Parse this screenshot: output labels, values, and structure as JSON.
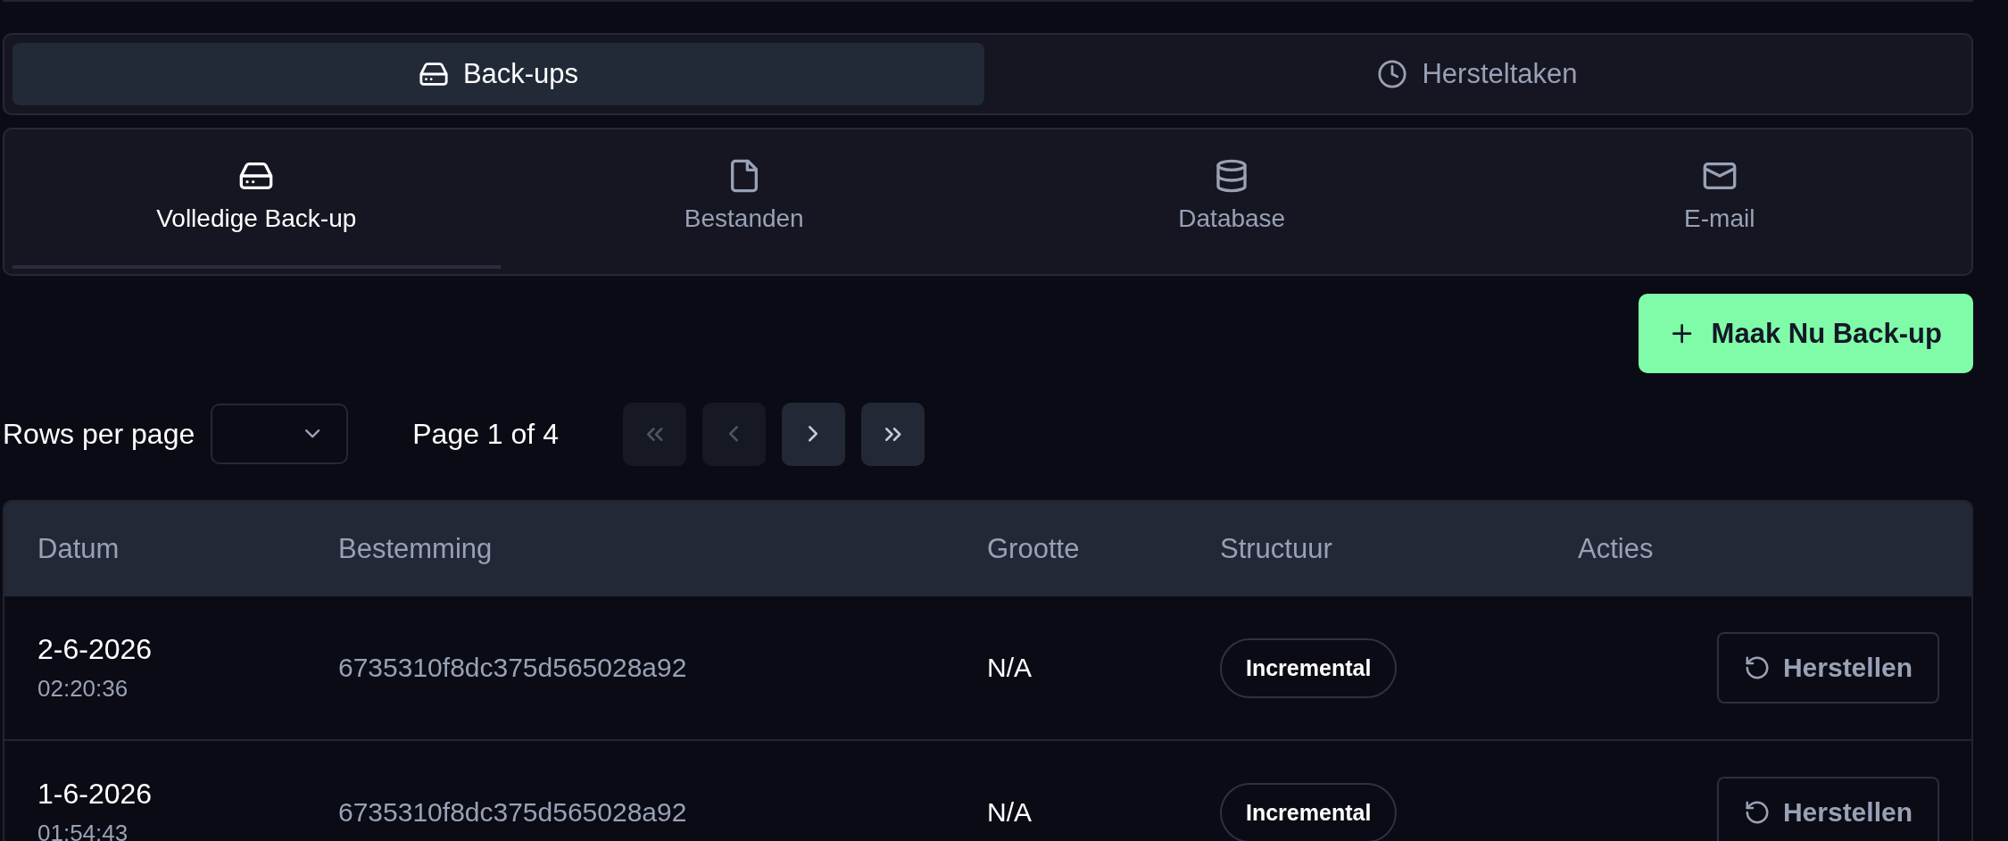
{
  "view_tabs": [
    {
      "label": "Back-ups",
      "selected": true
    },
    {
      "label": "Hersteltaken",
      "selected": false
    }
  ],
  "category_tabs": [
    {
      "label": "Volledige Back-up",
      "selected": true
    },
    {
      "label": "Bestanden",
      "selected": false
    },
    {
      "label": "Database",
      "selected": false
    },
    {
      "label": "E-mail",
      "selected": false
    }
  ],
  "create_button": {
    "label": "Maak Nu Back-up"
  },
  "pagination": {
    "rows_per_page_label": "Rows per page",
    "page_label": "Page 1 of 4",
    "buttons": [
      {
        "disabled": true
      },
      {
        "disabled": true
      },
      {
        "disabled": false
      },
      {
        "disabled": false
      }
    ]
  },
  "table": {
    "columns": [
      "Datum",
      "Bestemming",
      "Grootte",
      "Structuur",
      "Acties"
    ],
    "rows": [
      {
        "date": "2-6-2026",
        "time": "02:20:36",
        "destination": "6735310f8dc375d565028a92",
        "size": "N/A",
        "structure": "Incremental",
        "action": "Herstellen"
      },
      {
        "date": "1-6-2026",
        "time": "01:54:43",
        "destination": "6735310f8dc375d565028a92",
        "size": "N/A",
        "structure": "Incremental",
        "action": "Herstellen"
      }
    ]
  }
}
